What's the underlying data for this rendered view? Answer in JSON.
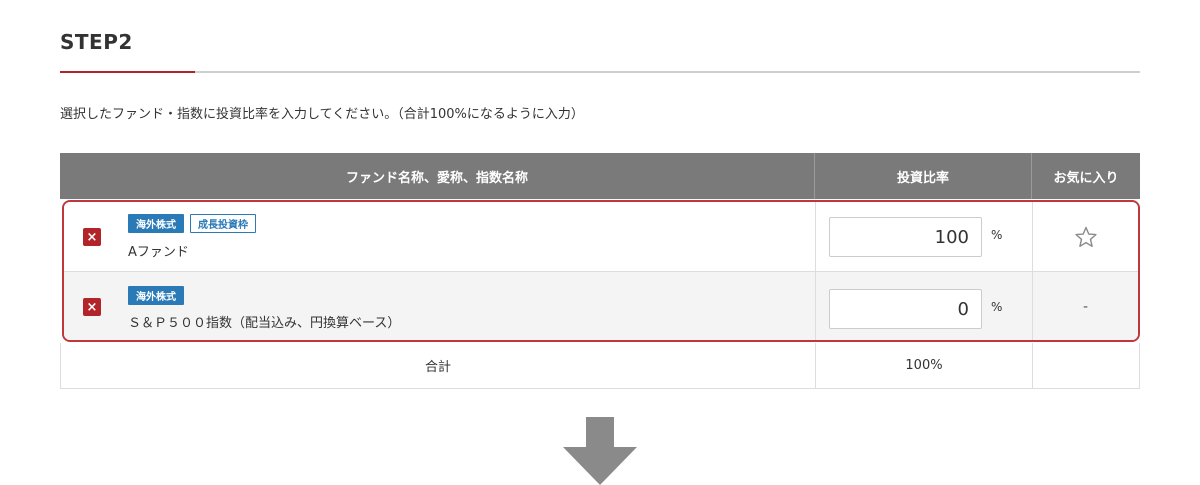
{
  "step": {
    "title": "STEP2"
  },
  "instruction": "選択したファンド・指数に投資比率を入力してください。（合計100%になるように入力）",
  "table": {
    "headers": {
      "name": "ファンド名称、愛称、指数名称",
      "ratio": "投資比率",
      "favorite": "お気に入り"
    },
    "rows": [
      {
        "delete_symbol": "×",
        "tags": [
          "海外株式",
          "成長投資枠"
        ],
        "name": "Aファンド",
        "ratio": "100",
        "unit": "%",
        "favorite": "star-outline-icon"
      },
      {
        "delete_symbol": "×",
        "tags": [
          "海外株式"
        ],
        "name": "Ｓ＆Ｐ５００指数（配当込み、円換算ベース）",
        "ratio": "0",
        "unit": "%",
        "favorite_text": "-"
      }
    ],
    "total": {
      "label": "合計",
      "value": "100%"
    }
  },
  "colors": {
    "accent": "#b3242a",
    "header_bg": "#7a7a7a",
    "tag_blue": "#2a7ab8",
    "highlight_border": "#c0363d",
    "arrow": "#8a8a8a"
  }
}
